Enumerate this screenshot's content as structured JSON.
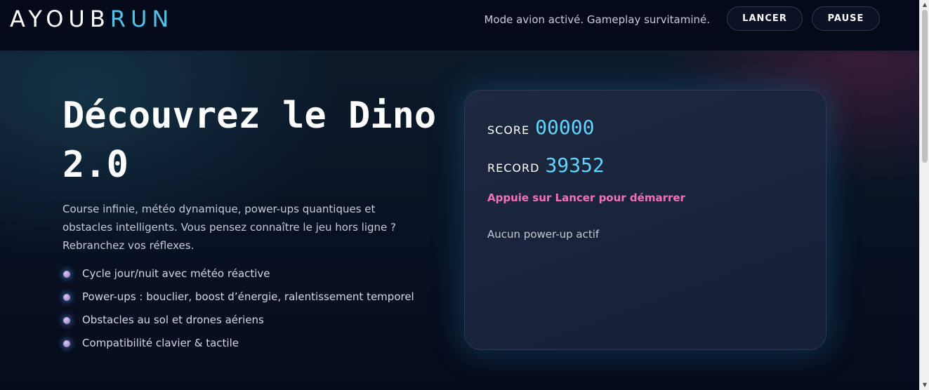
{
  "header": {
    "logo_main": "AYOUB",
    "logo_accent": "RUN",
    "tagline": "Mode avion activé. Gameplay survitaminé.",
    "start_label": "LANCER",
    "pause_label": "PAUSE"
  },
  "hero": {
    "title": "Découvrez le Dino 2.0",
    "description": "Course infinie, météo dynamique, power-ups quantiques et obstacles intelligents. Vous pensez connaître le jeu hors ligne ? Rebranchez vos réflexes.",
    "features": [
      "Cycle jour/nuit avec météo réactive",
      "Power-ups : bouclier, boost d’énergie, ralentissement temporel",
      "Obstacles au sol et drones aériens",
      "Compatibilité clavier & tactile"
    ]
  },
  "game_panel": {
    "score_label": "SCORE",
    "score_value": "00000",
    "record_label": "RECORD",
    "record_value": "39352",
    "prompt": "Appuie sur Lancer pour démarrer",
    "powerup_status": "Aucun power-up actif"
  },
  "colors": {
    "accent_cyan": "#4fc3e8",
    "score_cyan": "#5fd5ff",
    "prompt_pink": "#f472b6",
    "background": "#070b1c"
  },
  "icons": {
    "feature_bullet": "glowing-dot-icon",
    "scroll_up": "scroll-up-arrow-icon",
    "scroll_down": "scroll-down-arrow-icon"
  }
}
